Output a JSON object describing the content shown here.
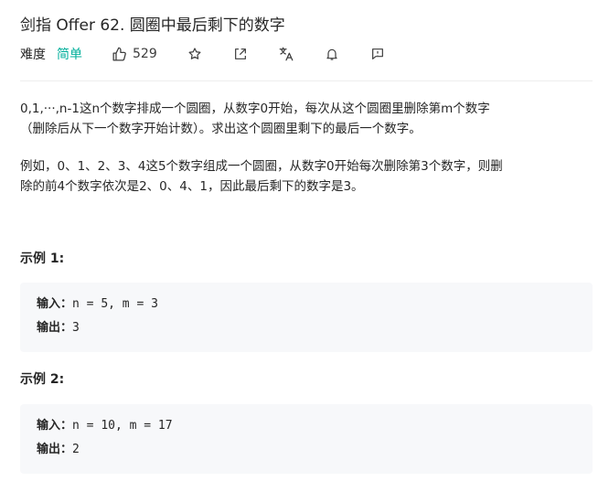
{
  "problem": {
    "title": "剑指 Offer 62. 圆圈中最后剩下的数字"
  },
  "meta": {
    "difficulty_label": "难度",
    "difficulty": "简单",
    "likes": "529",
    "accent": "#00af9b"
  },
  "description": {
    "p1_line1": "0,1,···,n-1这n个数字排成一个圆圈，从数字0开始，每次从这个圆圈里删除第m个数字",
    "p1_line2": "（删除后从下一个数字开始计数）。求出这个圆圈里剩下的最后一个数字。",
    "p2_line1": "例如，0、1、2、3、4这5个数字组成一个圆圈，从数字0开始每次删除第3个数字，则删",
    "p2_line2": "除的前4个数字依次是2、0、4、1，因此最后剩下的数字是3。"
  },
  "examples": [
    {
      "title": "示例 1:",
      "input_label": "输入：",
      "input": "n = 5, m = 3",
      "output_label": "输出：",
      "output": "3"
    },
    {
      "title": "示例 2:",
      "input_label": "输入：",
      "input": "n = 10, m = 17",
      "output_label": "输出：",
      "output": "2"
    }
  ],
  "icons": [
    "thumbs-up-icon",
    "star-icon",
    "share-icon",
    "translate-icon",
    "bell-icon",
    "feedback-icon"
  ]
}
